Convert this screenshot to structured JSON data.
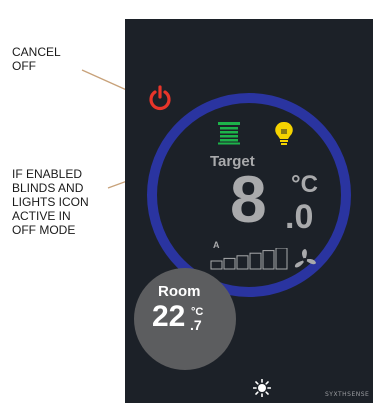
{
  "annotations": {
    "cancel_off": "CANCEL\nOFF",
    "blinds_lights": "IF ENABLED\nBLINDS AND\nLIGHTS ICON\nACTIVE IN\nOFF MODE"
  },
  "thermostat": {
    "target_label": "Target",
    "target_integer": "8",
    "target_decimal": ".0",
    "target_unit": "°C",
    "fan_mode": "A",
    "fan_levels_total": 6,
    "fan_levels_active": 0,
    "room_label": "Room",
    "room_integer": "22",
    "room_unit": "°C",
    "room_decimal": ".7",
    "brand": "SYXTHSENSE"
  },
  "icons": {
    "power": "power-icon",
    "blinds": "blinds-icon",
    "light": "light-bulb-icon",
    "fan": "fan-icon",
    "brightness": "sun-icon"
  },
  "colors": {
    "panel_background": "#1c2128",
    "ring": "#2a34a0",
    "power_icon": "#e8352a",
    "blinds_icon": "#1db34a",
    "bulb_icon": "#f5d300",
    "text_dim": "#a9aaac",
    "room_circle": "#5c5d5f"
  }
}
